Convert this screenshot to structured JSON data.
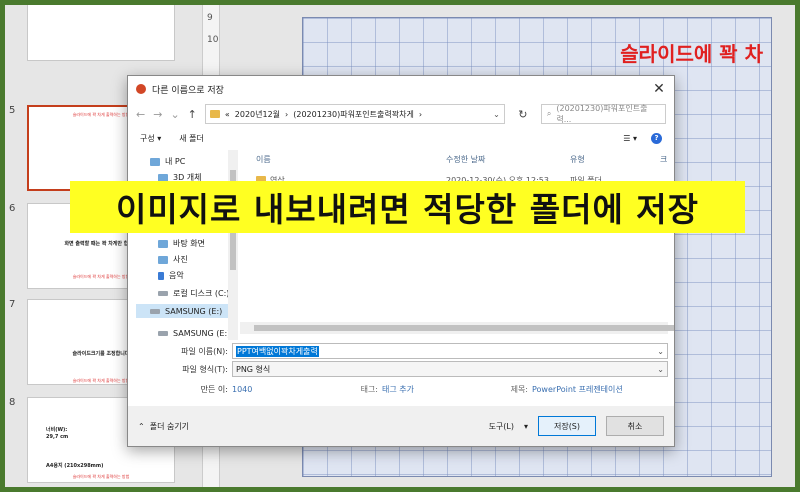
{
  "thumbnails": [
    {
      "number": "5",
      "lines": [
        "슬라이드에 꽉 차게 출력하는 방법"
      ],
      "selected": true
    },
    {
      "number": "6",
      "lines": [
        "화면 출력할 때는 꽉 차게만 합니다",
        "슬라이드에 꽉 차게 출력하는 방법"
      ]
    },
    {
      "number": "7",
      "lines": [
        "슬라이드크기를 조정합니다",
        "슬라이드에 꽉 차게 출력하는 방법"
      ]
    },
    {
      "number": "8",
      "lines": [
        "너비(W):",
        "29,7 cm",
        "A4용지 (210x298mm)",
        "슬라이드에 꽉 차게 출력하는 방법"
      ]
    }
  ],
  "ruler_marks": [
    "9",
    "10"
  ],
  "slide": {
    "title_text": "슬라이드에 꽉 차"
  },
  "dialog": {
    "title": "다른 이름으로 저장",
    "close_glyph": "✕",
    "address": {
      "parts": [
        "«",
        "2020년12월",
        "›",
        "(20201230)파워포인트출력꽉차게",
        "›"
      ]
    },
    "search_placeholder": "(20201230)파워포인트출력...",
    "toolbar": {
      "organize": "구성 ▾",
      "new_folder": "새 폴더"
    },
    "nav_items": [
      {
        "label": "내 PC",
        "selected": false
      },
      {
        "label": "3D 개체",
        "selected": false
      },
      {
        "label": "바탕 화면",
        "selected": false
      },
      {
        "label": "사진",
        "selected": false
      },
      {
        "label": "음악",
        "selected": false
      },
      {
        "label": "로컬 디스크 (C:)",
        "selected": false
      },
      {
        "label": "SAMSUNG (E:)",
        "selected": true
      },
      {
        "label": "SAMSUNG (E:)",
        "selected": false
      }
    ],
    "columns": {
      "name": "이름",
      "modified": "수정한 날짜",
      "type": "유형",
      "size": "크"
    },
    "files": [
      {
        "name": "영상",
        "modified": "2020-12-30(수) 오후 12:53",
        "type": "파일 폴더"
      }
    ],
    "filename_label": "파일 이름(N):",
    "filename_value": "PPT여백없이꽉차게출력",
    "filetype_label": "파일 형식(T):",
    "filetype_value": "PNG 형식",
    "author_label": "만든 이:",
    "author_value": "1040",
    "tags_label": "태그:",
    "tags_value": "태그 추가",
    "subject_label": "제목:",
    "subject_value": "PowerPoint 프레젠테이션",
    "hide_folders": "폴더 숨기기",
    "tools": "도구(L)",
    "save": "저장(S)",
    "cancel": "취소"
  },
  "caption": "이미지로 내보내려면 적당한 폴더에 저장",
  "colors": {
    "frame": "#4a7a2e",
    "caption_bg": "#ffff22",
    "accent": "#0078d7",
    "slide_title": "#e02020"
  }
}
